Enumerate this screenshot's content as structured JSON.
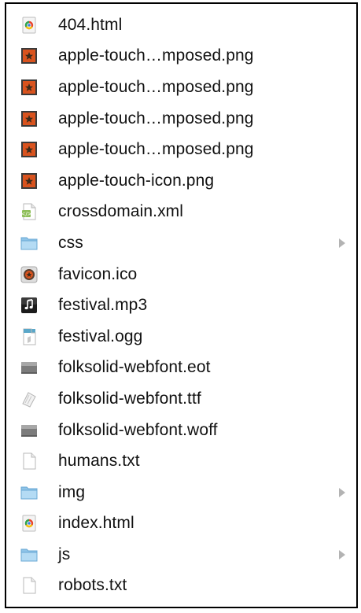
{
  "files": [
    {
      "name": "404.html",
      "icon": "chrome-html-icon",
      "folder": false
    },
    {
      "name": "apple-touch…mposed.png",
      "icon": "png-image-icon",
      "folder": false
    },
    {
      "name": "apple-touch…mposed.png",
      "icon": "png-image-icon",
      "folder": false
    },
    {
      "name": "apple-touch…mposed.png",
      "icon": "png-image-icon",
      "folder": false
    },
    {
      "name": "apple-touch…mposed.png",
      "icon": "png-image-icon",
      "folder": false
    },
    {
      "name": "apple-touch-icon.png",
      "icon": "png-image-icon",
      "folder": false
    },
    {
      "name": "crossdomain.xml",
      "icon": "xml-file-icon",
      "folder": false
    },
    {
      "name": "css",
      "icon": "folder-icon",
      "folder": true
    },
    {
      "name": "favicon.ico",
      "icon": "ico-file-icon",
      "folder": false
    },
    {
      "name": "festival.mp3",
      "icon": "music-file-icon",
      "folder": false
    },
    {
      "name": "festival.ogg",
      "icon": "ogg-file-icon",
      "folder": false
    },
    {
      "name": "folksolid-webfont.eot",
      "icon": "font-file-icon",
      "folder": false
    },
    {
      "name": "folksolid-webfont.ttf",
      "icon": "ttf-font-icon",
      "folder": false
    },
    {
      "name": "folksolid-webfont.woff",
      "icon": "font-file-icon",
      "folder": false
    },
    {
      "name": "humans.txt",
      "icon": "text-file-icon",
      "folder": false
    },
    {
      "name": "img",
      "icon": "folder-icon",
      "folder": true
    },
    {
      "name": "index.html",
      "icon": "chrome-html-icon",
      "folder": false
    },
    {
      "name": "js",
      "icon": "folder-icon",
      "folder": true
    },
    {
      "name": "robots.txt",
      "icon": "text-file-icon",
      "folder": false
    }
  ],
  "colors": {
    "border": "#000000",
    "text": "#111111",
    "folder": "#8fc4e8",
    "disclosure": "#b3b3b3"
  }
}
